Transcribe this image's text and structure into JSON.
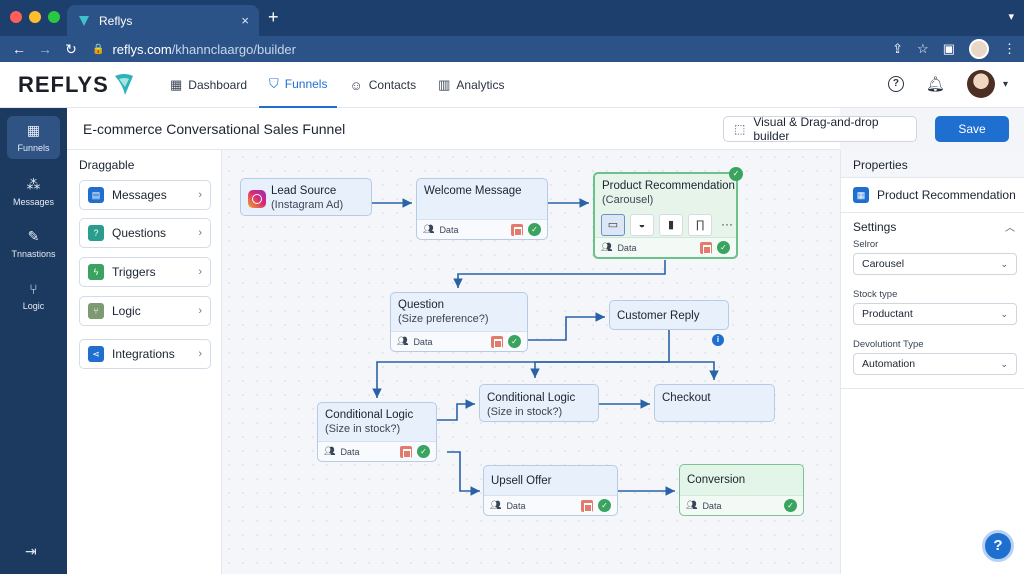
{
  "browser": {
    "tab_title": "Reflys",
    "tab_close": "×",
    "new_tab": "+",
    "url_host": "reflys.com",
    "url_path": "/khannclaargo/builder"
  },
  "app": {
    "logo": "REFLYS",
    "nav": [
      {
        "label": "Dashboard",
        "icon": "dashboard-icon"
      },
      {
        "label": "Funnels",
        "icon": "funnel-icon"
      },
      {
        "label": "Contacts",
        "icon": "contacts-icon"
      },
      {
        "label": "Analytics",
        "icon": "analytics-icon"
      }
    ],
    "active_nav": "Funnels"
  },
  "rail": {
    "items": [
      {
        "label": "Funnels",
        "icon": "grid-icon"
      },
      {
        "label": "Messages",
        "icon": "nodes-icon"
      },
      {
        "label": "Tnnastions",
        "icon": "edit-icon"
      },
      {
        "label": "Logic",
        "icon": "logic-icon"
      }
    ]
  },
  "title_bar": {
    "title": "E-commerce Conversational Sales Funnel",
    "builder_label": "Visual & Drag-and-drop builder",
    "save_label": "Save"
  },
  "draggable": {
    "title": "Draggable",
    "items": [
      {
        "label": "Messages",
        "color": "#1f6fd1"
      },
      {
        "label": "Questions",
        "color": "#2a9d8f"
      },
      {
        "label": "Triggers",
        "color": "#3aa35f"
      },
      {
        "label": "Logic",
        "color": "#7d9a72"
      },
      {
        "label": "Integrations",
        "color": "#1f6fd1"
      }
    ]
  },
  "canvas": {
    "nodes": {
      "lead": {
        "title": "Lead Source",
        "sub": "(Instagram Ad)"
      },
      "welcome": {
        "title": "Welcome Message",
        "foot": "Data"
      },
      "product": {
        "title": "Product Recommendation",
        "sub": "(Carousel)",
        "foot": "Data"
      },
      "question": {
        "title": "Question",
        "sub": "(Size preference?)",
        "foot": "Data"
      },
      "reply": {
        "title": "Customer Reply"
      },
      "cond_mid": {
        "title": "Conditional Logic",
        "sub": "(Size in stock?)"
      },
      "checkout": {
        "title": "Checkout"
      },
      "cond_left": {
        "title": "Conditional Logic",
        "sub": "(Size in stock?)",
        "foot": "Data"
      },
      "upsell": {
        "title": "Upsell Offer",
        "foot": "Data"
      },
      "conversion": {
        "title": "Conversion",
        "foot": "Data"
      }
    },
    "more": "···"
  },
  "properties": {
    "title": "Properties",
    "node_name": "Product Recommendation",
    "settings_title": "Settings",
    "fields": [
      {
        "label": "Selror",
        "value": "Carousel"
      },
      {
        "label": "Stock type",
        "value": "Productant"
      },
      {
        "label": "Devolutiont Type",
        "value": "Automation"
      }
    ]
  },
  "colors": {
    "accent": "#1f6fd1",
    "rail": "#1c3a5f",
    "success": "#3aa35f"
  }
}
